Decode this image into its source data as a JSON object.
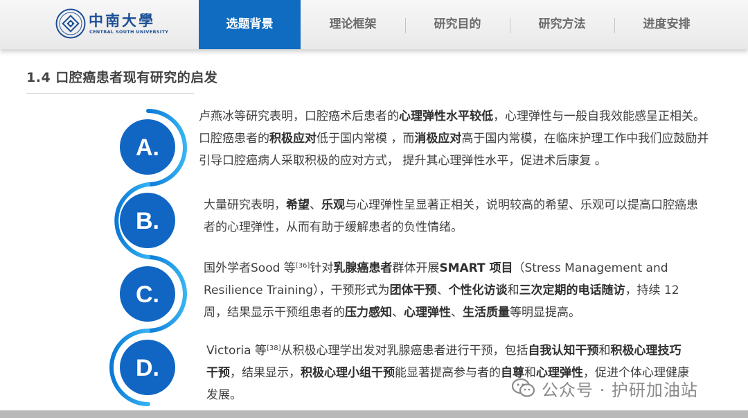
{
  "logo": {
    "cn_text": "中南大學",
    "en_text": "CENTRAL SOUTH UNIVERSITY"
  },
  "nav": {
    "tabs": [
      {
        "label": "选题背景",
        "active": true
      },
      {
        "label": "理论框架",
        "active": false
      },
      {
        "label": "研究目的",
        "active": false
      },
      {
        "label": "研究方法",
        "active": false
      },
      {
        "label": "进度安排",
        "active": false
      }
    ]
  },
  "section": {
    "title": "1.4  口腔癌患者现有研究的启发"
  },
  "markers": [
    "A.",
    "B.",
    "C.",
    "D."
  ],
  "paragraphs": {
    "a": [
      {
        "t": "卢燕冰等研究表明，口腔癌术后患者的"
      },
      {
        "t": "心理弹性水平较低",
        "b": true
      },
      {
        "t": "，心理弹性与一般自我效能感呈正相关。口腔癌患者的"
      },
      {
        "t": "积极应对",
        "b": true
      },
      {
        "t": "低于国内常模 ，而"
      },
      {
        "t": "消极应对",
        "b": true
      },
      {
        "t": "高于国内常模，在临床护理工作中我们应鼓励并引导口腔癌病人采取积极的应对方式， 提升其心理弹性水平，促进术后康复 。"
      }
    ],
    "b": [
      {
        "t": "大量研究表明，"
      },
      {
        "t": "希望",
        "b": true
      },
      {
        "t": "、"
      },
      {
        "t": "乐观",
        "b": true
      },
      {
        "t": "与心理弹性呈显著正相关，说明较高的希望、乐观可以提高口腔癌患者的心理弹性，从而有助于缓解患者的负性情绪。"
      }
    ],
    "c": [
      {
        "t": "国外学者Sood 等"
      },
      {
        "t": "[36]",
        "sup": true
      },
      {
        "t": "针对"
      },
      {
        "t": "乳腺癌患者",
        "b": true
      },
      {
        "t": "群体开展"
      },
      {
        "t": "SMART 项目",
        "b": true
      },
      {
        "t": "（Stress Management and Resilience Training），干预形式为"
      },
      {
        "t": "团体干预",
        "b": true
      },
      {
        "t": "、"
      },
      {
        "t": "个性化访谈",
        "b": true
      },
      {
        "t": "和"
      },
      {
        "t": "三次定期的电话随访",
        "b": true
      },
      {
        "t": "，持续 12 周，结果显示干预组患者的"
      },
      {
        "t": "压力感知",
        "b": true
      },
      {
        "t": "、"
      },
      {
        "t": "心理弹性",
        "b": true
      },
      {
        "t": "、"
      },
      {
        "t": "生活质量",
        "b": true
      },
      {
        "t": "等明显提高。"
      }
    ],
    "d": [
      {
        "t": "Victoria 等"
      },
      {
        "t": "[38]",
        "sup": true
      },
      {
        "t": "从积极心理学出发对乳腺癌患者进行干预，包括"
      },
      {
        "t": "自我认知干预",
        "b": true
      },
      {
        "t": "和"
      },
      {
        "t": "积极心理技巧干预",
        "b": true
      },
      {
        "t": "，结果显示，"
      },
      {
        "t": "积极心理小组干预",
        "b": true
      },
      {
        "t": "能显著提高参与者的"
      },
      {
        "t": "自尊",
        "b": true
      },
      {
        "t": "和"
      },
      {
        "t": "心理弹性",
        "b": true
      },
      {
        "t": "，促进个体心理健康发展。"
      }
    ]
  },
  "watermark": {
    "text": "公众号 · 护研加油站",
    "icon": "wechat-icon"
  },
  "colors": {
    "primary_blue": "#0f6cc0",
    "marker_blue": "#1166c4",
    "arc_light_blue": "#2aa5ee",
    "header_bg": "#f2f2f2"
  }
}
